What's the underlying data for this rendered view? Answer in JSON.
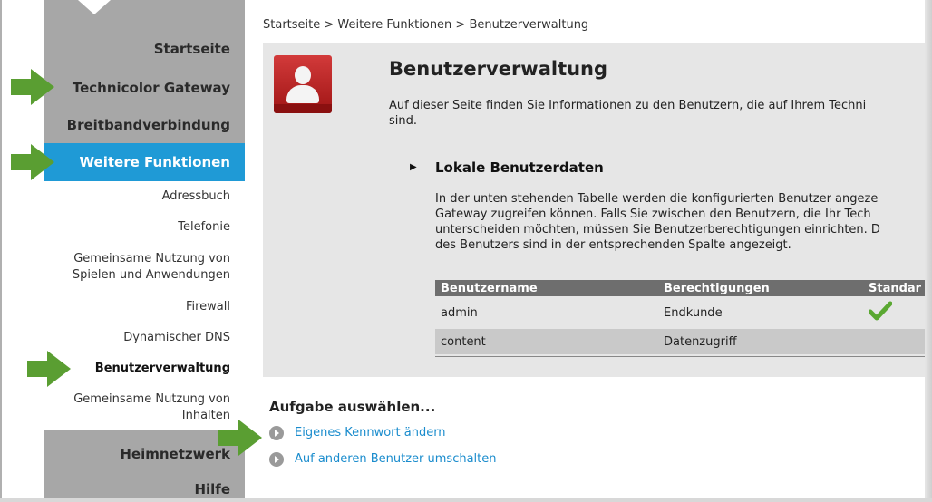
{
  "breadcrumb": "Startseite > Weitere Funktionen > Benutzerverwaltung",
  "nav": {
    "main_top": [
      "Startseite",
      "Technicolor Gateway",
      "Breitbandverbindung"
    ],
    "active": "Weitere Funktionen",
    "sub": [
      "Adressbuch",
      "Telefonie",
      "Gemeinsame Nutzung von",
      "Spielen und Anwendungen",
      "Firewall",
      "Dynamischer DNS",
      "Benutzerverwaltung",
      "Gemeinsame Nutzung von",
      "Inhalten"
    ],
    "main_bottom": [
      "Heimnetzwerk",
      "Hilfe"
    ]
  },
  "page": {
    "title": "Benutzerverwaltung",
    "intro_line1": "Auf dieser Seite finden Sie Informationen zu den Benutzern, die auf Ihrem Techni",
    "intro_line2": "sind."
  },
  "section": {
    "title": "Lokale Benutzerdaten",
    "lines": [
      "In der unten stehenden Tabelle werden die konfigurierten Benutzer angeze",
      "Gateway zugreifen können. Falls Sie zwischen den Benutzern, die Ihr Tech",
      "unterscheiden möchten, müssen Sie Benutzerberechtigungen einrichten. D",
      "des Benutzers sind in der entsprechenden Spalte angezeigt."
    ]
  },
  "table": {
    "headers": [
      "Benutzername",
      "Berechtigungen",
      "Standar"
    ],
    "rows": [
      [
        "admin",
        "Endkunde"
      ],
      [
        "content",
        "Datenzugriff"
      ]
    ]
  },
  "tasks": {
    "title": "Aufgabe auswählen...",
    "items": [
      "Eigenes Kennwort ändern",
      "Auf anderen Benutzer umschalten"
    ]
  },
  "colors": {
    "accent": "#1f9ad6",
    "link": "#1a8ccd",
    "arrow": "#5a9e32",
    "check": "#5aa832",
    "icon_red": "#c42424"
  },
  "icons": [
    "user-icon",
    "check-icon",
    "arrow-right-icon",
    "triangle-bullet-icon"
  ]
}
